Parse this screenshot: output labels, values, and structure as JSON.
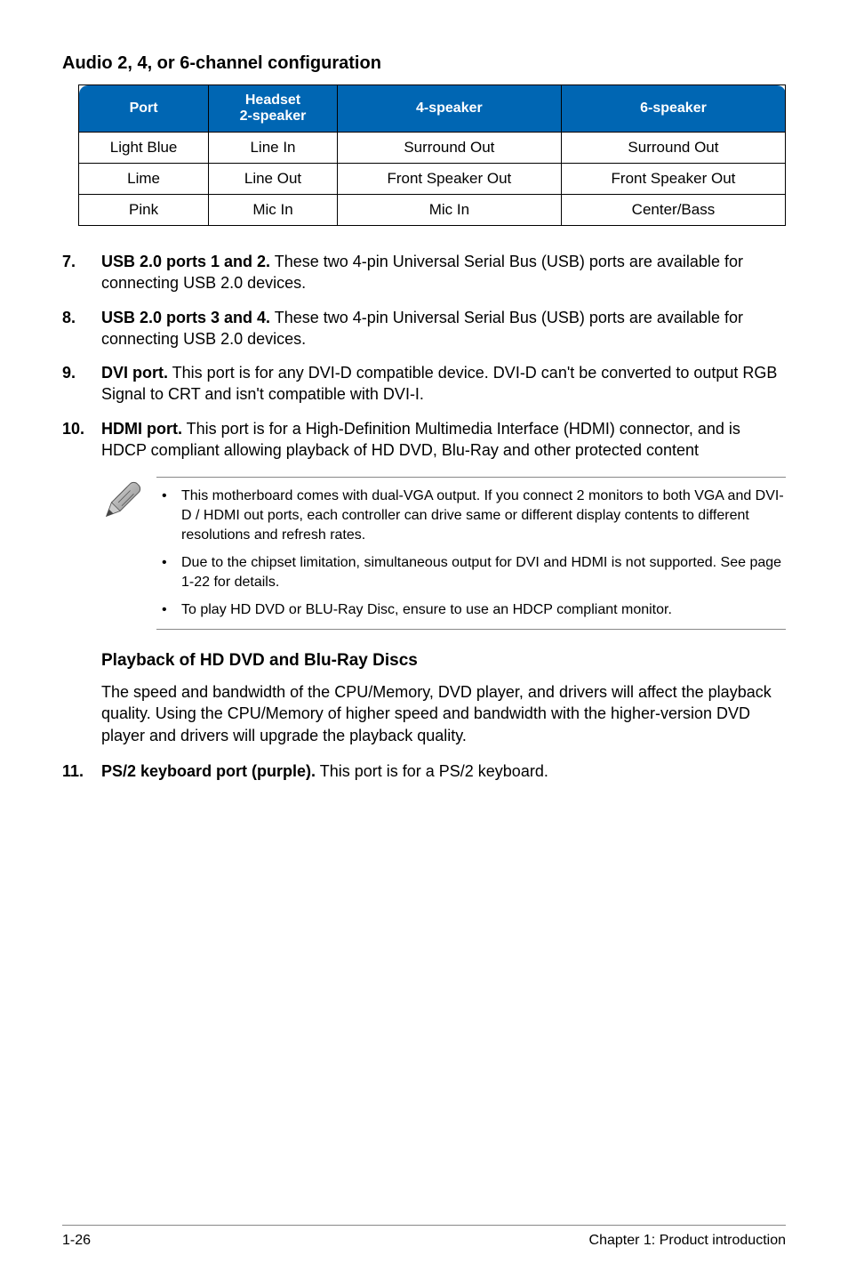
{
  "section_title": "Audio 2, 4, or 6-channel configuration",
  "table": {
    "headers": {
      "port": "Port",
      "headset_line1": "Headset",
      "headset_line2": "2-speaker",
      "four_speaker": "4-speaker",
      "six_speaker": "6-speaker"
    },
    "rows": [
      {
        "port": "Light Blue",
        "headset": "Line In",
        "four": "Surround Out",
        "six": "Surround Out"
      },
      {
        "port": "Lime",
        "headset": "Line Out",
        "four": "Front Speaker Out",
        "six": "Front Speaker Out"
      },
      {
        "port": "Pink",
        "headset": "Mic In",
        "four": "Mic In",
        "six": "Center/Bass"
      }
    ]
  },
  "items": [
    {
      "num": "7.",
      "lead": "USB 2.0 ports 1 and 2.",
      "rest": " These two 4-pin Universal Serial Bus (USB) ports are available for connecting USB 2.0 devices."
    },
    {
      "num": "8.",
      "lead": "USB 2.0 ports 3 and 4.",
      "rest": " These two 4-pin Universal Serial Bus (USB) ports are available for connecting USB 2.0 devices."
    },
    {
      "num": "9.",
      "lead": "DVI port.",
      "rest": " This port is for any DVI-D compatible device. DVI-D can't be converted to output RGB  Signal to CRT and isn't compatible with DVI-I."
    },
    {
      "num": "10.",
      "lead": "HDMI port.",
      "rest": " This port is for a High-Definition Multimedia Interface (HDMI) connector, and is HDCP compliant allowing playback of HD DVD, Blu-Ray and other protected content"
    }
  ],
  "notes": [
    "This motherboard comes with dual-VGA output. If you connect 2 monitors to both VGA and DVI-D / HDMI out ports, each controller can drive same or different display contents to different resolutions and refresh rates.",
    "Due to the chipset limitation, simultaneous output for DVI and HDMI is not supported. See page 1-22 for details.",
    "To play HD DVD or BLU-Ray Disc, ensure to use an HDCP compliant monitor."
  ],
  "subsection_title": "Playback of HD DVD and Blu-Ray Discs",
  "body_para": "The speed and bandwidth of the CPU/Memory, DVD player, and drivers will affect the playback quality. Using the CPU/Memory of higher speed and bandwidth with the higher-version DVD player and drivers will upgrade the playback quality.",
  "item11": {
    "num": "11.",
    "lead": "PS/2 keyboard port (purple).",
    "rest": " This port is for a PS/2 keyboard."
  },
  "footer": {
    "left": "1-26",
    "right": "Chapter 1: Product introduction"
  },
  "bullet_char": "•",
  "icons": {
    "note_pencil": "pencil-icon"
  }
}
